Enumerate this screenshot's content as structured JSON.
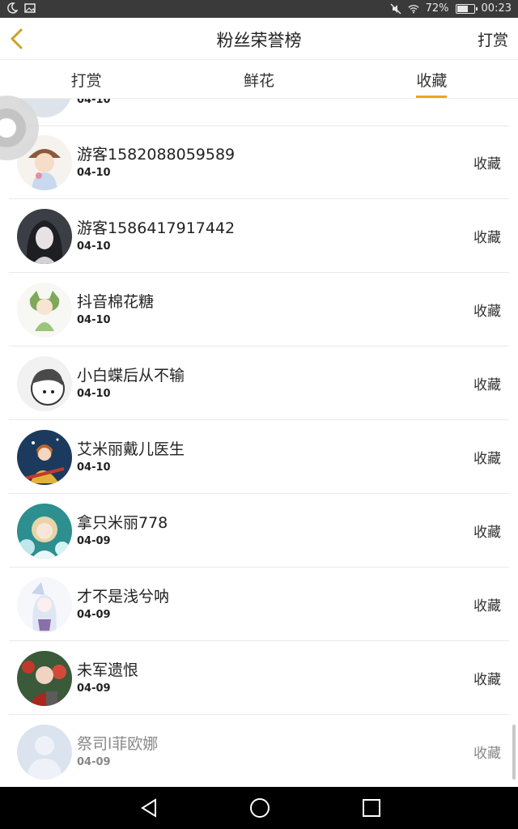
{
  "status_bar": {
    "battery": "72%",
    "time": "00:23",
    "battery_level": 0.72,
    "icons": [
      "moon-icon",
      "image-icon",
      "mute-icon",
      "wifi-icon",
      "battery-icon"
    ]
  },
  "header": {
    "title": "粉丝荣誉榜",
    "action": "打赏"
  },
  "tabs": [
    {
      "label": "打赏",
      "active": false
    },
    {
      "label": "鲜花",
      "active": false
    },
    {
      "label": "收藏",
      "active": true
    }
  ],
  "accent_color": "#f0a41c",
  "partial_row": {
    "date": "04-10"
  },
  "list": [
    {
      "name": "游客1582088059589",
      "date": "04-10",
      "action": "收藏"
    },
    {
      "name": "游客1586417917442",
      "date": "04-10",
      "action": "收藏"
    },
    {
      "name": "抖音棉花糖",
      "date": "04-10",
      "action": "收藏"
    },
    {
      "name": "小白蝶后从不输",
      "date": "04-10",
      "action": "收藏"
    },
    {
      "name": "艾米丽戴儿医生",
      "date": "04-10",
      "action": "收藏"
    },
    {
      "name": "拿只米丽778",
      "date": "04-09",
      "action": "收藏"
    },
    {
      "name": "才不是浅兮呐",
      "date": "04-09",
      "action": "收藏"
    },
    {
      "name": "未军遗恨",
      "date": "04-09",
      "action": "收藏"
    },
    {
      "name": "祭司l菲欧娜",
      "date": "04-09",
      "action": "收藏"
    }
  ],
  "nav": [
    "back-nav-icon",
    "home-nav-icon",
    "recents-nav-icon"
  ]
}
